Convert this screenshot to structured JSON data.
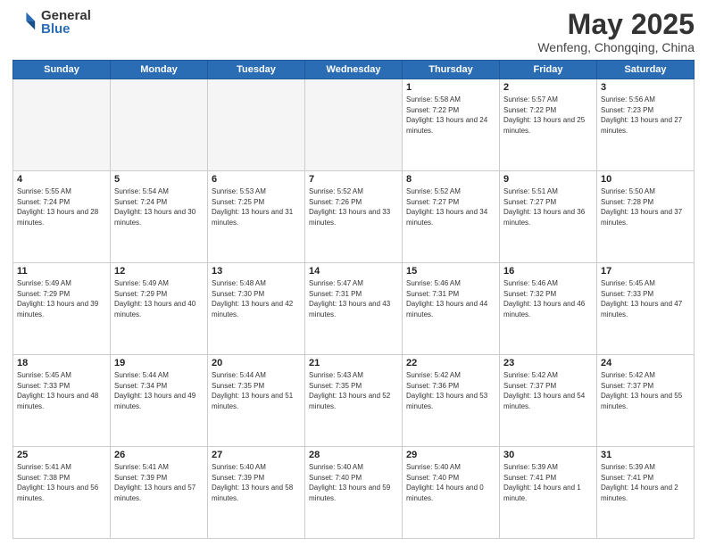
{
  "logo": {
    "general": "General",
    "blue": "Blue"
  },
  "header": {
    "month": "May 2025",
    "location": "Wenfeng, Chongqing, China"
  },
  "weekdays": [
    "Sunday",
    "Monday",
    "Tuesday",
    "Wednesday",
    "Thursday",
    "Friday",
    "Saturday"
  ],
  "weeks": [
    [
      {
        "day": "",
        "empty": true
      },
      {
        "day": "",
        "empty": true
      },
      {
        "day": "",
        "empty": true
      },
      {
        "day": "",
        "empty": true
      },
      {
        "day": "1",
        "sunrise": "5:58 AM",
        "sunset": "7:22 PM",
        "daylight": "13 hours and 24 minutes."
      },
      {
        "day": "2",
        "sunrise": "5:57 AM",
        "sunset": "7:22 PM",
        "daylight": "13 hours and 25 minutes."
      },
      {
        "day": "3",
        "sunrise": "5:56 AM",
        "sunset": "7:23 PM",
        "daylight": "13 hours and 27 minutes."
      }
    ],
    [
      {
        "day": "4",
        "sunrise": "5:55 AM",
        "sunset": "7:24 PM",
        "daylight": "13 hours and 28 minutes."
      },
      {
        "day": "5",
        "sunrise": "5:54 AM",
        "sunset": "7:24 PM",
        "daylight": "13 hours and 30 minutes."
      },
      {
        "day": "6",
        "sunrise": "5:53 AM",
        "sunset": "7:25 PM",
        "daylight": "13 hours and 31 minutes."
      },
      {
        "day": "7",
        "sunrise": "5:52 AM",
        "sunset": "7:26 PM",
        "daylight": "13 hours and 33 minutes."
      },
      {
        "day": "8",
        "sunrise": "5:52 AM",
        "sunset": "7:27 PM",
        "daylight": "13 hours and 34 minutes."
      },
      {
        "day": "9",
        "sunrise": "5:51 AM",
        "sunset": "7:27 PM",
        "daylight": "13 hours and 36 minutes."
      },
      {
        "day": "10",
        "sunrise": "5:50 AM",
        "sunset": "7:28 PM",
        "daylight": "13 hours and 37 minutes."
      }
    ],
    [
      {
        "day": "11",
        "sunrise": "5:49 AM",
        "sunset": "7:29 PM",
        "daylight": "13 hours and 39 minutes."
      },
      {
        "day": "12",
        "sunrise": "5:49 AM",
        "sunset": "7:29 PM",
        "daylight": "13 hours and 40 minutes."
      },
      {
        "day": "13",
        "sunrise": "5:48 AM",
        "sunset": "7:30 PM",
        "daylight": "13 hours and 42 minutes."
      },
      {
        "day": "14",
        "sunrise": "5:47 AM",
        "sunset": "7:31 PM",
        "daylight": "13 hours and 43 minutes."
      },
      {
        "day": "15",
        "sunrise": "5:46 AM",
        "sunset": "7:31 PM",
        "daylight": "13 hours and 44 minutes."
      },
      {
        "day": "16",
        "sunrise": "5:46 AM",
        "sunset": "7:32 PM",
        "daylight": "13 hours and 46 minutes."
      },
      {
        "day": "17",
        "sunrise": "5:45 AM",
        "sunset": "7:33 PM",
        "daylight": "13 hours and 47 minutes."
      }
    ],
    [
      {
        "day": "18",
        "sunrise": "5:45 AM",
        "sunset": "7:33 PM",
        "daylight": "13 hours and 48 minutes."
      },
      {
        "day": "19",
        "sunrise": "5:44 AM",
        "sunset": "7:34 PM",
        "daylight": "13 hours and 49 minutes."
      },
      {
        "day": "20",
        "sunrise": "5:44 AM",
        "sunset": "7:35 PM",
        "daylight": "13 hours and 51 minutes."
      },
      {
        "day": "21",
        "sunrise": "5:43 AM",
        "sunset": "7:35 PM",
        "daylight": "13 hours and 52 minutes."
      },
      {
        "day": "22",
        "sunrise": "5:42 AM",
        "sunset": "7:36 PM",
        "daylight": "13 hours and 53 minutes."
      },
      {
        "day": "23",
        "sunrise": "5:42 AM",
        "sunset": "7:37 PM",
        "daylight": "13 hours and 54 minutes."
      },
      {
        "day": "24",
        "sunrise": "5:42 AM",
        "sunset": "7:37 PM",
        "daylight": "13 hours and 55 minutes."
      }
    ],
    [
      {
        "day": "25",
        "sunrise": "5:41 AM",
        "sunset": "7:38 PM",
        "daylight": "13 hours and 56 minutes."
      },
      {
        "day": "26",
        "sunrise": "5:41 AM",
        "sunset": "7:39 PM",
        "daylight": "13 hours and 57 minutes."
      },
      {
        "day": "27",
        "sunrise": "5:40 AM",
        "sunset": "7:39 PM",
        "daylight": "13 hours and 58 minutes."
      },
      {
        "day": "28",
        "sunrise": "5:40 AM",
        "sunset": "7:40 PM",
        "daylight": "13 hours and 59 minutes."
      },
      {
        "day": "29",
        "sunrise": "5:40 AM",
        "sunset": "7:40 PM",
        "daylight": "14 hours and 0 minutes."
      },
      {
        "day": "30",
        "sunrise": "5:39 AM",
        "sunset": "7:41 PM",
        "daylight": "14 hours and 1 minute."
      },
      {
        "day": "31",
        "sunrise": "5:39 AM",
        "sunset": "7:41 PM",
        "daylight": "14 hours and 2 minutes."
      }
    ]
  ]
}
